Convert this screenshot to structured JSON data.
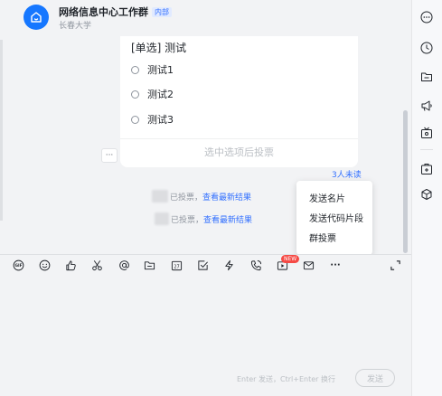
{
  "header": {
    "title": "网络信息中心工作群",
    "tag": "内部",
    "subtitle": "长春大学"
  },
  "poll": {
    "title": "[单选] 测试",
    "options": [
      "测试1",
      "测试2",
      "测试3"
    ],
    "submit_hint": "选中选项后投票",
    "more": "···"
  },
  "unread_text": "3人未读",
  "vote_notices": [
    {
      "text": "已投票，",
      "link": "查看最新结果"
    },
    {
      "text": "已投票，",
      "link": "查看最新结果"
    }
  ],
  "popup_menu": [
    "发送名片",
    "发送代码片段",
    "群投票"
  ],
  "toolbar": {
    "icons": [
      "gif-icon",
      "emoji-icon",
      "thumbs-up-icon",
      "scissors-icon",
      "at-icon",
      "folder-icon",
      "calendar-icon",
      "checkbox-icon",
      "lightning-icon",
      "phone-icon",
      "video-meeting-icon",
      "mail-icon",
      "more-icon",
      "expand-icon"
    ],
    "calendar_day": "27",
    "new_badge": "NEW",
    "more": "···"
  },
  "editor": {
    "hint": "Enter 发送，Ctrl+Enter 换行",
    "send_label": "发送"
  },
  "sidebar_icons": [
    "more-icon",
    "clock-icon",
    "folder-icon",
    "announcement-icon",
    "tv-icon",
    "add-app-icon",
    "cube-icon"
  ],
  "colors": {
    "accent": "#3370ff",
    "avatar": "#1677ff",
    "badge": "#f54a45"
  }
}
